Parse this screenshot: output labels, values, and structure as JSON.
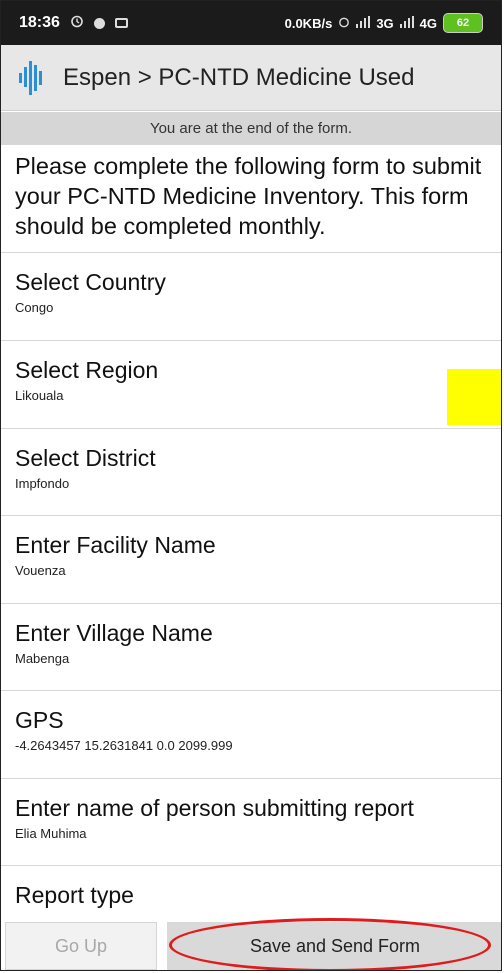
{
  "status_bar": {
    "time": "18:36",
    "alarm_icon": "alarm-icon",
    "net_speed": "0.0KB/s",
    "signal_text": "3G",
    "signal_text_2": "4G",
    "battery": "62"
  },
  "app_bar": {
    "title": "Espen > PC-NTD Medicine Used"
  },
  "banner": {
    "text": "You are at the end of the form."
  },
  "intro": {
    "text": "Please complete the following form to submit your PC-NTD Medicine Inventory. This form should be completed monthly."
  },
  "fields": [
    {
      "label": "Select Country",
      "value": "Congo"
    },
    {
      "label": "Select Region",
      "value": "Likouala"
    },
    {
      "label": "Select District",
      "value": "Impfondo"
    },
    {
      "label": "Enter Facility Name",
      "value": "Vouenza"
    },
    {
      "label": "Enter Village Name",
      "value": "Mabenga"
    },
    {
      "label": "GPS",
      "value": "-4.2643457 15.2631841 0.0 2099.999"
    },
    {
      "label": "Enter name of person submitting report",
      "value": "Elia Muhima"
    },
    {
      "label": "Report type",
      "value": ""
    }
  ],
  "buttons": {
    "go_up": "Go Up",
    "save_send": "Save and Send Form"
  },
  "colors": {
    "status_bar": "#1b1b1b",
    "app_bar": "#e7e7e7",
    "banner": "#d6d6d6",
    "highlight": "#ffff00",
    "annotation_ring": "#e01b1b",
    "battery": "#5fc11f"
  }
}
